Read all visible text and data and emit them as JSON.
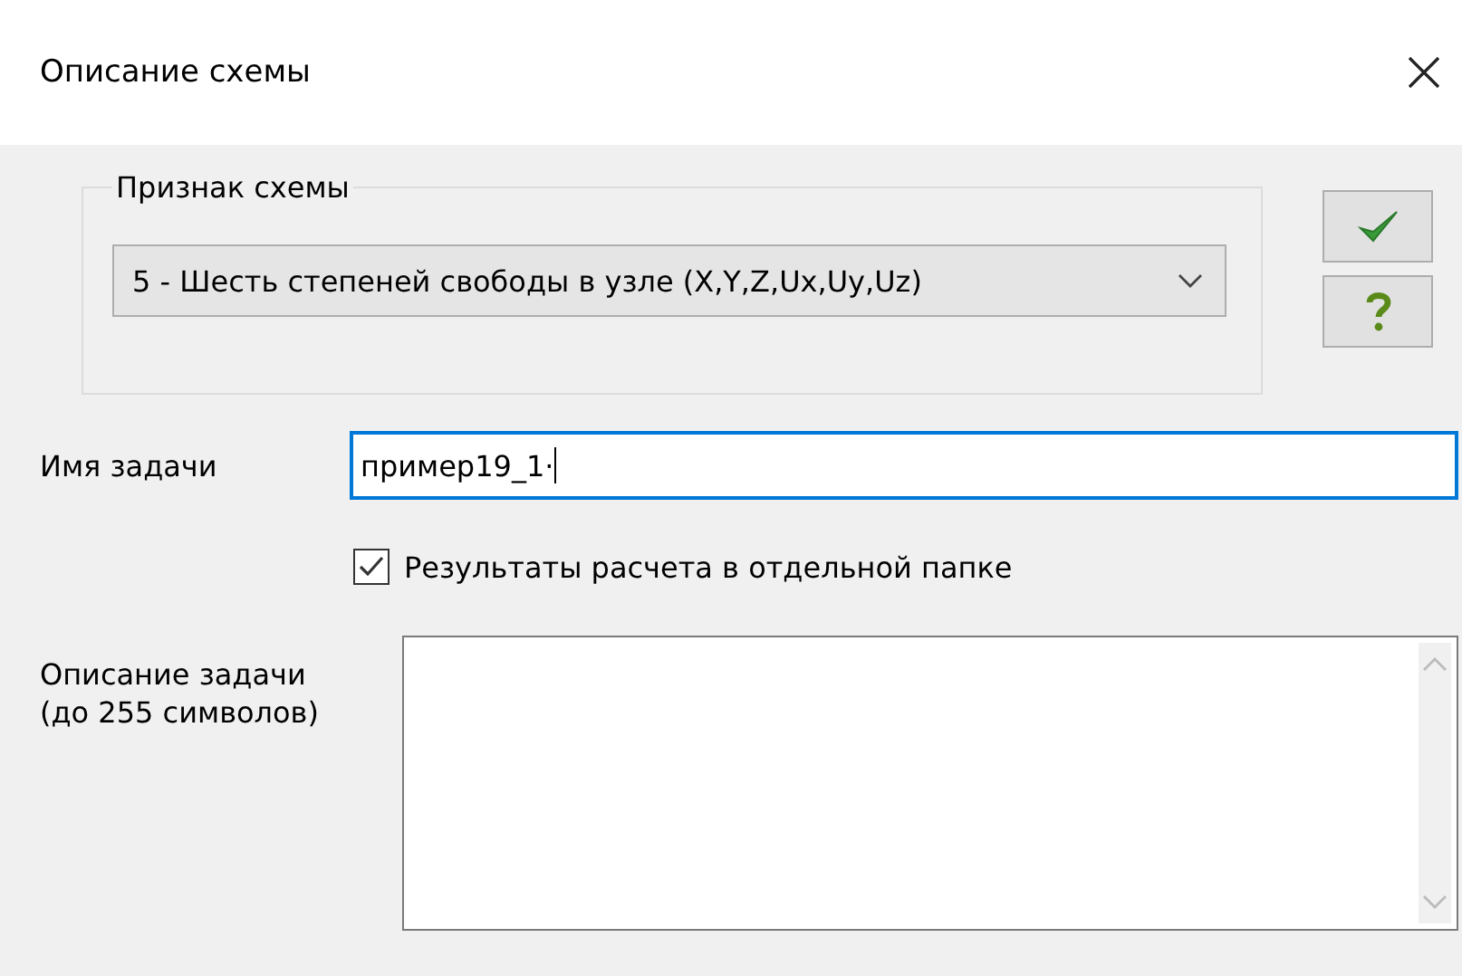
{
  "window": {
    "title": "Описание схемы"
  },
  "scheme_group": {
    "legend": "Признак схемы",
    "combo": {
      "value": "5 - Шесть степеней свободы в узле (X,Y,Z,Ux,Uy,Uz)"
    }
  },
  "side_buttons": [
    {
      "kind": "ok"
    },
    {
      "kind": "help"
    }
  ],
  "task_name": {
    "label": "Имя задачи",
    "value": "пример19_1·"
  },
  "separate_folder": {
    "label": "Результаты расчета в отдельной папке",
    "checked": true
  },
  "description": {
    "label": "Описание задачи (до 255 символов)"
  }
}
